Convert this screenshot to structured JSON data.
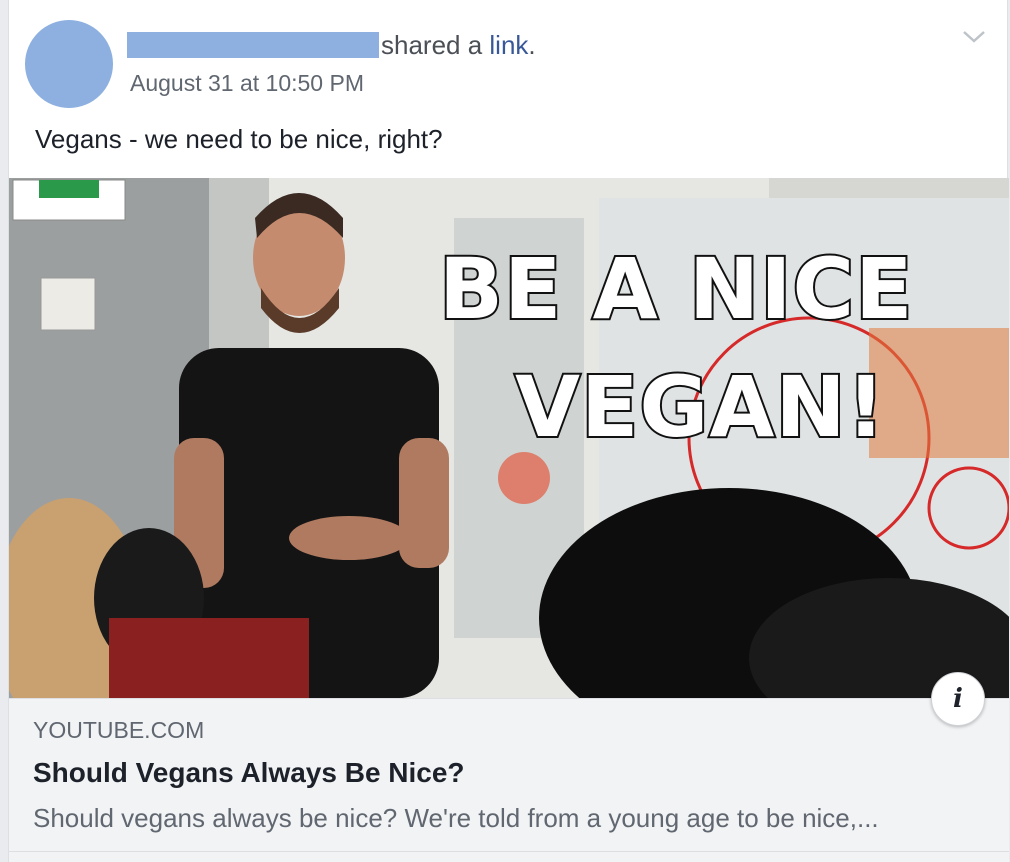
{
  "post": {
    "action_prefix": "shared a ",
    "action_link": "link",
    "action_suffix": ".",
    "timestamp": "August 31 at 10:50 PM",
    "message": "Vegans - we need to be nice, right?"
  },
  "media": {
    "overlay_line_1": "BE A NICE",
    "overlay_line_2": "VEGAN!",
    "info_label": "i"
  },
  "link_preview": {
    "domain": "YOUTUBE.COM",
    "title": "Should Vegans Always Be Nice?",
    "description": "Should vegans always be nice? We're told from a young age to be nice,..."
  },
  "icons": {
    "options": "chevron-down-icon",
    "info": "info-icon"
  },
  "colors": {
    "link": "#385898",
    "avatar_placeholder": "#8db0e0",
    "preview_bg": "#f2f3f5"
  }
}
